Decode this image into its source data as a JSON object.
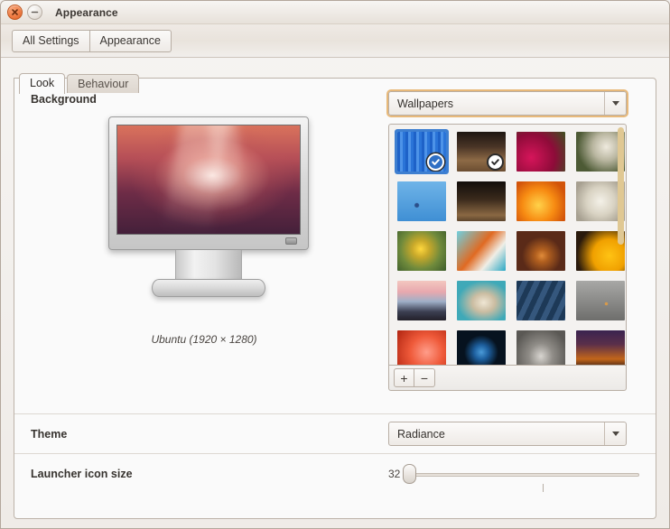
{
  "window": {
    "title": "Appearance",
    "close_icon": "close-icon",
    "minimize_icon": "minimize-icon"
  },
  "toolbar": {
    "all_settings_label": "All Settings",
    "appearance_label": "Appearance"
  },
  "tabs": [
    {
      "label": "Look",
      "active": true
    },
    {
      "label": "Behaviour",
      "active": false
    }
  ],
  "background": {
    "section_label": "Background",
    "monitor_caption": "Ubuntu (1920 × 1280)",
    "source_combo": {
      "value": "Wallpapers",
      "arrow_icon": "chevron-down-icon",
      "focused": true
    },
    "grid_buttons": {
      "add_label": "+",
      "remove_label": "−"
    },
    "thumbnails": [
      {
        "name": "blue-stripes",
        "selected": true,
        "badge": "check-blue"
      },
      {
        "name": "wood-floor",
        "selected": false,
        "badge": "check-white"
      },
      {
        "name": "red-petal",
        "selected": false,
        "badge": null
      },
      {
        "name": "white-blossom",
        "selected": false,
        "badge": null
      },
      {
        "name": "birds-sky",
        "selected": false,
        "badge": null
      },
      {
        "name": "dark-wood-room",
        "selected": false,
        "badge": null
      },
      {
        "name": "orange-poppy",
        "selected": false,
        "badge": null
      },
      {
        "name": "dandelion-seed",
        "selected": false,
        "badge": null
      },
      {
        "name": "yellow-flower-bud",
        "selected": false,
        "badge": null
      },
      {
        "name": "painted-fish",
        "selected": false,
        "badge": null
      },
      {
        "name": "brown-leather-leaf",
        "selected": false,
        "badge": null
      },
      {
        "name": "orange-mesh-hat",
        "selected": false,
        "badge": null
      },
      {
        "name": "pink-sunset-city",
        "selected": false,
        "badge": null
      },
      {
        "name": "rope-knot",
        "selected": false,
        "badge": null
      },
      {
        "name": "blue-metal-roof",
        "selected": false,
        "badge": null
      },
      {
        "name": "gray-branch-buds",
        "selected": false,
        "badge": null
      },
      {
        "name": "red-gradient",
        "selected": false,
        "badge": null
      },
      {
        "name": "earth-space",
        "selected": false,
        "badge": null
      },
      {
        "name": "gray-stones",
        "selected": false,
        "badge": null
      },
      {
        "name": "purple-sunset",
        "selected": false,
        "badge": null
      }
    ]
  },
  "theme": {
    "label": "Theme",
    "value": "Radiance",
    "arrow_icon": "chevron-down-icon"
  },
  "launcher": {
    "label": "Launcher icon size",
    "value": "32"
  },
  "colors": {
    "accent_orange": "#ef7c43",
    "focus_ring": "#e8b97a",
    "selection_blue": "#3e7fd0",
    "scrollbar": "#e0c893",
    "window_bg": "#f2f0ee",
    "panel_bg": "#fafafa"
  }
}
